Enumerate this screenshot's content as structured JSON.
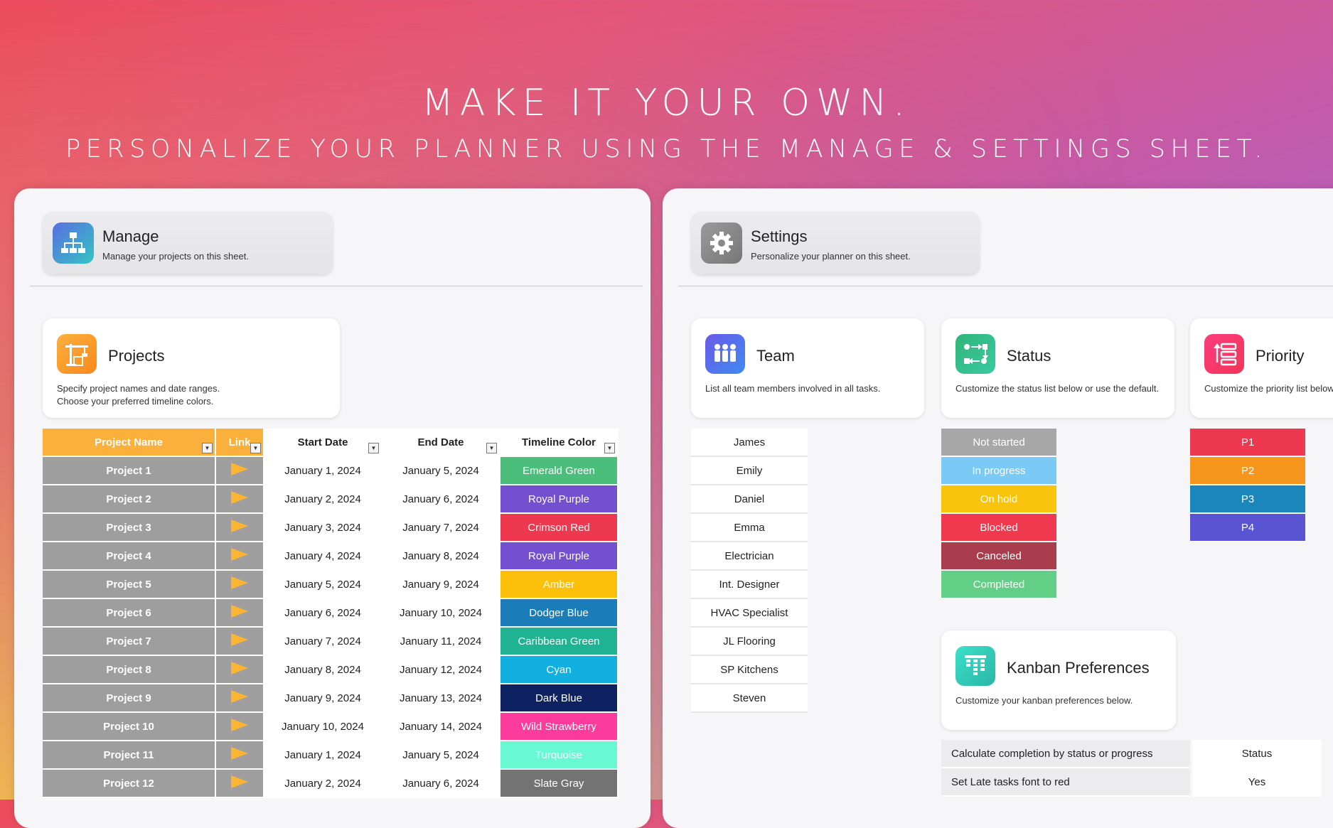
{
  "hero": {
    "title": "MAKE IT YOUR OWN.",
    "subtitle": "PERSONALIZE YOUR PLANNER USING THE MANAGE & SETTINGS SHEET."
  },
  "manage": {
    "title": "Manage",
    "subtitle": "Manage your projects on this sheet.",
    "icon": "sitemap-icon"
  },
  "settings": {
    "title": "Settings",
    "subtitle": "Personalize your planner on this sheet.",
    "icon": "gear-icon"
  },
  "projects_card": {
    "title": "Projects",
    "description": "Specify project names and date ranges.\nChoose your preferred timeline colors.",
    "icon": "crane-icon"
  },
  "projects_table": {
    "headers": {
      "name": "Project Name",
      "link": "Link",
      "start": "Start Date",
      "end": "End Date",
      "color": "Timeline Color"
    },
    "rows": [
      {
        "name": "Project 1",
        "start": "January 1, 2024",
        "end": "January 5, 2024",
        "color_name": "Emerald Green",
        "color": "#4cbe7c"
      },
      {
        "name": "Project 2",
        "start": "January 2, 2024",
        "end": "January 6, 2024",
        "color_name": "Royal Purple",
        "color": "#7350d0"
      },
      {
        "name": "Project 3",
        "start": "January 3, 2024",
        "end": "January 7, 2024",
        "color_name": "Crimson Red",
        "color": "#ee3850"
      },
      {
        "name": "Project 4",
        "start": "January 4, 2024",
        "end": "January 8, 2024",
        "color_name": "Royal Purple",
        "color": "#7350d0"
      },
      {
        "name": "Project 5",
        "start": "January 5, 2024",
        "end": "January 9, 2024",
        "color_name": "Amber",
        "color": "#fcc00a"
      },
      {
        "name": "Project 6",
        "start": "January 6, 2024",
        "end": "January 10, 2024",
        "color_name": "Dodger Blue",
        "color": "#1b7cba"
      },
      {
        "name": "Project 7",
        "start": "January 7, 2024",
        "end": "January 11, 2024",
        "color_name": "Caribbean Green",
        "color": "#1fb394"
      },
      {
        "name": "Project 8",
        "start": "January 8, 2024",
        "end": "January 12, 2024",
        "color_name": "Cyan",
        "color": "#12b0e0"
      },
      {
        "name": "Project 9",
        "start": "January 9, 2024",
        "end": "January 13, 2024",
        "color_name": "Dark Blue",
        "color": "#0e2262"
      },
      {
        "name": "Project 10",
        "start": "January 10, 2024",
        "end": "January 14, 2024",
        "color_name": "Wild Strawberry",
        "color": "#fc3b9c"
      },
      {
        "name": "Project 11",
        "start": "January 1, 2024",
        "end": "January 5, 2024",
        "color_name": "Turquoise",
        "color": "#68f8d2"
      },
      {
        "name": "Project 12",
        "start": "January 2, 2024",
        "end": "January 6, 2024",
        "color_name": "Slate Gray",
        "color": "#737373"
      }
    ]
  },
  "team_card": {
    "title": "Team",
    "description": "List all team members involved in all tasks.",
    "icon": "team-icon"
  },
  "team": [
    "James",
    "Emily",
    "Daniel",
    "Emma",
    "Electrician",
    "Int. Designer",
    "HVAC Specialist",
    "JL Flooring",
    "SP Kitchens",
    "Steven"
  ],
  "status_card": {
    "title": "Status",
    "description": "Customize the status list below or use the default.",
    "icon": "workflow-icon"
  },
  "status": [
    {
      "label": "Not started",
      "color": "#a7a7a7"
    },
    {
      "label": "In progress",
      "color": "#7bcaf5"
    },
    {
      "label": "On hold",
      "color": "#f9c40c"
    },
    {
      "label": "Blocked",
      "color": "#f0384e"
    },
    {
      "label": "Canceled",
      "color": "#a93d4e"
    },
    {
      "label": "Completed",
      "color": "#63cf86"
    }
  ],
  "priority_card": {
    "title": "Priority",
    "description": "Customize the priority list below.",
    "icon": "priority-icon"
  },
  "priority": [
    {
      "label": "P1",
      "color": "#ee3850"
    },
    {
      "label": "P2",
      "color": "#f7961c"
    },
    {
      "label": "P3",
      "color": "#1b86bb"
    },
    {
      "label": "P4",
      "color": "#5a54d2"
    }
  ],
  "kanban_card": {
    "title": "Kanban Preferences",
    "description": "Customize your kanban preferences below.",
    "icon": "kanban-icon"
  },
  "kanban_prefs": [
    {
      "question": "Calculate completion by status or progress",
      "answer": "Status"
    },
    {
      "question": "Set Late tasks font to red",
      "answer": "Yes"
    }
  ]
}
